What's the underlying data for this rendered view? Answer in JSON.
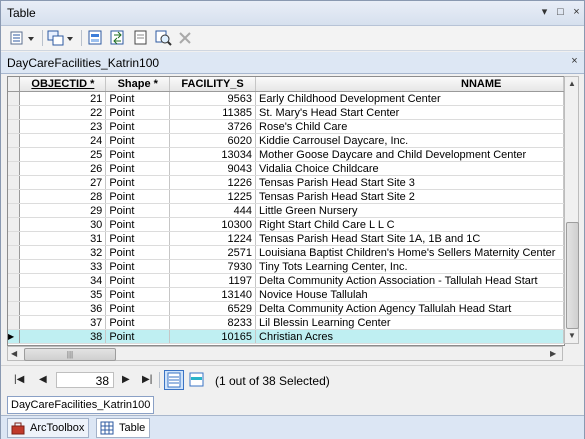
{
  "window": {
    "title": "Table",
    "controls": [
      "▾",
      "□",
      "×"
    ]
  },
  "toolbar": {
    "buttons": [
      "table-options-icon",
      "related-tables-icon",
      "select-by-attributes-icon",
      "switch-selection-icon",
      "clear-selection-icon",
      "zoom-to-selected-icon",
      "delete-selected-icon"
    ]
  },
  "table_tab": {
    "title": "DayCareFacilities_Katrin100",
    "close": "×"
  },
  "grid": {
    "columns": [
      "OBJECTID *",
      "Shape *",
      "FACILITY_S",
      "NNAME"
    ],
    "rows": [
      {
        "id": "21",
        "shape": "Point",
        "fac": "9563",
        "name": "Early Childhood Development Center"
      },
      {
        "id": "22",
        "shape": "Point",
        "fac": "11385",
        "name": "St. Mary's Head Start Center"
      },
      {
        "id": "23",
        "shape": "Point",
        "fac": "3726",
        "name": "Rose's Child Care"
      },
      {
        "id": "24",
        "shape": "Point",
        "fac": "6020",
        "name": "Kiddie Carrousel Daycare, Inc."
      },
      {
        "id": "25",
        "shape": "Point",
        "fac": "13034",
        "name": "Mother Goose Daycare and Child Development Center"
      },
      {
        "id": "26",
        "shape": "Point",
        "fac": "9043",
        "name": "Vidalia Choice Childcare"
      },
      {
        "id": "27",
        "shape": "Point",
        "fac": "1226",
        "name": "Tensas Parish Head Start Site 3"
      },
      {
        "id": "28",
        "shape": "Point",
        "fac": "1225",
        "name": "Tensas Parish Head Start Site 2"
      },
      {
        "id": "29",
        "shape": "Point",
        "fac": "444",
        "name": "Little Green Nursery"
      },
      {
        "id": "30",
        "shape": "Point",
        "fac": "10300",
        "name": "Right Start Child Care L L C"
      },
      {
        "id": "31",
        "shape": "Point",
        "fac": "1224",
        "name": "Tensas Parish Head Start Site 1A, 1B and 1C"
      },
      {
        "id": "32",
        "shape": "Point",
        "fac": "2571",
        "name": "Louisiana Baptist Children's Home's Sellers Maternity Center"
      },
      {
        "id": "33",
        "shape": "Point",
        "fac": "7930",
        "name": "Tiny Tots Learning Center, Inc."
      },
      {
        "id": "34",
        "shape": "Point",
        "fac": "1197",
        "name": "Delta Community Action Association - Tallulah Head Start"
      },
      {
        "id": "35",
        "shape": "Point",
        "fac": "13140",
        "name": "Novice House Tallulah"
      },
      {
        "id": "36",
        "shape": "Point",
        "fac": "6529",
        "name": "Delta Community Action Agency Tallulah Head Start"
      },
      {
        "id": "37",
        "shape": "Point",
        "fac": "8233",
        "name": "Lil Blessin Learning Center"
      },
      {
        "id": "38",
        "shape": "Point",
        "fac": "10165",
        "name": "Christian Acres"
      }
    ],
    "selected_row_index": 17,
    "selected_row_color": "#bfeff2"
  },
  "nav": {
    "first": "|◀",
    "prev": "◀",
    "record": "38",
    "next": "▶",
    "last": "▶|",
    "status": "(1 out of 38 Selected)"
  },
  "bottom_tab": {
    "label": "DayCareFacilities_Katrin100"
  },
  "window_tabs": [
    {
      "label": "ArcToolbox",
      "icon": "arctoolbox-icon"
    },
    {
      "label": "Table",
      "icon": "table-icon"
    }
  ]
}
